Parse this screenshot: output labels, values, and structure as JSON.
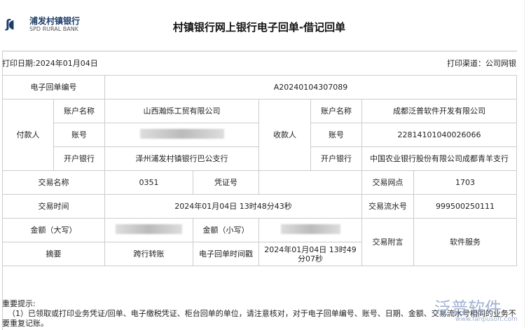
{
  "logo": {
    "cn": "浦发村镇银行",
    "en": "SPD RURAL BANK"
  },
  "title": "村镇银行网上银行电子回单-借记回单",
  "print_date": "打印日期:2024年01月04日",
  "print_channel": "打印渠道：公司网银",
  "receipt_no_label": "电子回单编号",
  "receipt_no": "A20240104307089",
  "payer": {
    "label": "付款人",
    "name_label": "账户名称",
    "name": "山西瀚烁工贸有限公司",
    "acct_label": "账号",
    "bank_label": "开户银行",
    "bank": "泽州浦发村镇银行巴公支行"
  },
  "payee": {
    "label": "收款人",
    "name_label": "账户名称",
    "name": "成都泛普软件开发有限公司",
    "acct_label": "账号",
    "acct": "22814101040026066",
    "bank_label": "开户银行",
    "bank": "中国农业银行股份有限公司成都青羊支行"
  },
  "tx": {
    "name_label": "交易名称",
    "name": "0351",
    "voucher_label": "凭证号",
    "voucher": "",
    "branch_label": "交易网点",
    "branch": "1703",
    "time_label": "交易时间",
    "time": "2024年01月04日 13时48分43秒",
    "serial_label": "交易流水号",
    "serial": "999500250111",
    "amt_big_label": "金额（大写）",
    "amt_small_label": "金额（小写）",
    "memo_label": "交易附言",
    "memo": "软件服务",
    "summary_label": "摘要",
    "summary": "跨行转账",
    "stamp_label": "电子回单时间戳",
    "stamp": "2024年01月04日 13时49分07秒"
  },
  "notes": {
    "heading": "重要提示:",
    "text": "（1）已领取或打印业务凭证/回单、电子缴税凭证、柜台回单的单位，请注意核对，对于电子回单编号、账号、日期、金额、交易流水号相同的业务不要重复记账。"
  },
  "watermark": {
    "text": "泛普软件",
    "url": "www.fanpusoft.com"
  }
}
